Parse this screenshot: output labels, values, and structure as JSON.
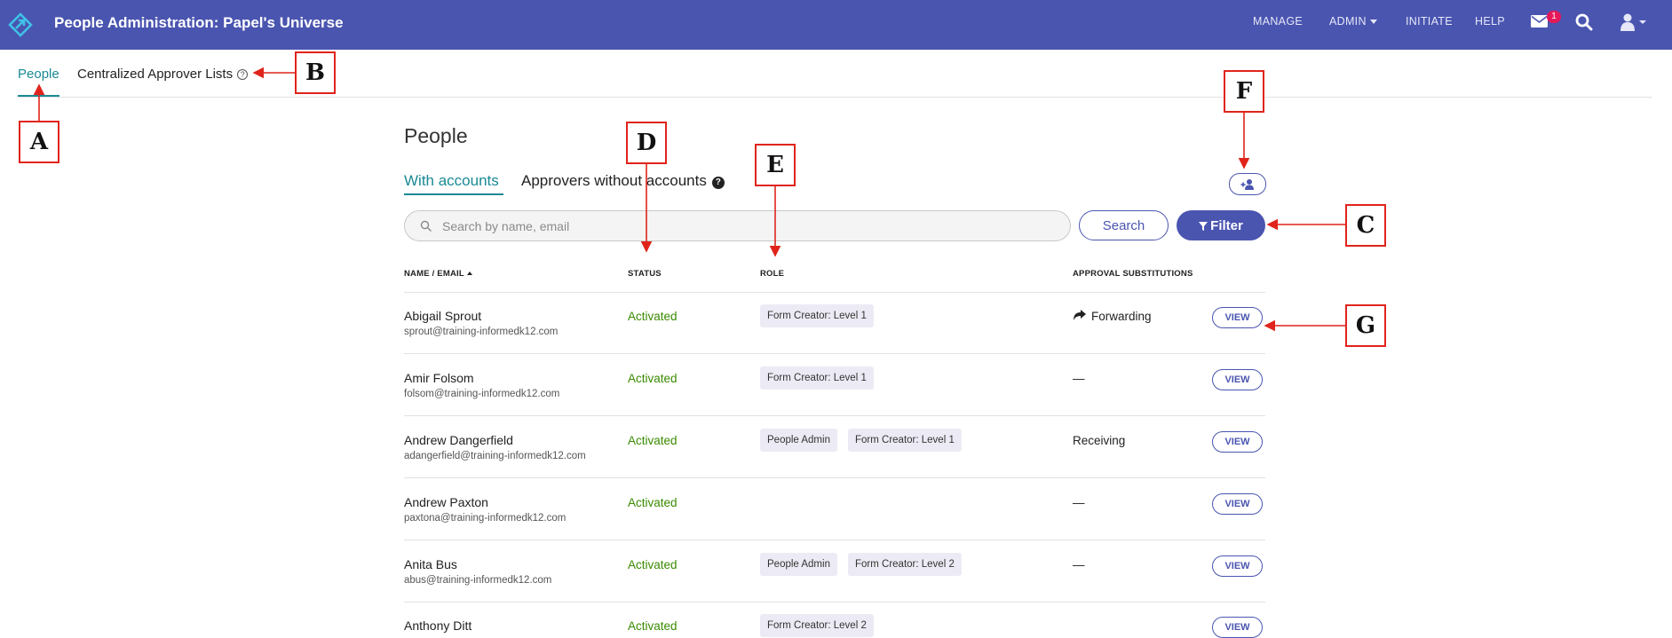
{
  "topbar": {
    "title": "People Administration: Papel's Universe",
    "nav": [
      "MANAGE",
      "ADMIN",
      "INITIATE",
      "HELP"
    ],
    "mail_badge": "1",
    "icons": [
      "app-logo-icon",
      "mail-icon",
      "search-icon",
      "user-icon"
    ]
  },
  "tabs": {
    "people": "People",
    "approver_lists": "Centralized Approver Lists",
    "help_glyph": "?"
  },
  "page": {
    "title": "People",
    "subtab_with": "With accounts",
    "subtab_without": "Approvers without accounts",
    "help_glyph": "?"
  },
  "search": {
    "placeholder": "Search by name, email",
    "value": "",
    "search_label": "Search",
    "filter_label": "Filter"
  },
  "table": {
    "headers": {
      "name": "NAME / EMAIL",
      "status": "STATUS",
      "role": "ROLE",
      "subs": "APPROVAL SUBSTITUTIONS"
    },
    "view_label": "VIEW",
    "rows": [
      {
        "name": "Abigail Sprout",
        "email": "sprout@training-informedk12.com",
        "status": "Activated",
        "roles": [
          "Form Creator: Level 1"
        ],
        "subs": "Forwarding"
      },
      {
        "name": "Amir Folsom",
        "email": "folsom@training-informedk12.com",
        "status": "Activated",
        "roles": [
          "Form Creator: Level 1"
        ],
        "subs": "—"
      },
      {
        "name": "Andrew Dangerfield",
        "email": "adangerfield@training-informedk12.com",
        "status": "Activated",
        "roles": [
          "People Admin",
          "Form Creator: Level 1"
        ],
        "subs": "Receiving"
      },
      {
        "name": "Andrew Paxton",
        "email": "paxtona@training-informedk12.com",
        "status": "Activated",
        "roles": [],
        "subs": "—"
      },
      {
        "name": "Anita Bus",
        "email": "abus@training-informedk12.com",
        "status": "Activated",
        "roles": [
          "People Admin",
          "Form Creator: Level 2"
        ],
        "subs": "—"
      },
      {
        "name": "Anthony Ditt",
        "email": "",
        "status": "Activated",
        "roles": [
          "Form Creator: Level 2"
        ],
        "subs": ""
      }
    ]
  },
  "annotations": [
    "A",
    "B",
    "C",
    "D",
    "E",
    "F",
    "G"
  ],
  "colors": {
    "topbar": "#4a55b0",
    "accent_teal": "#1a8a94",
    "status_green": "#3a8a00",
    "annotation_red": "#e0241b",
    "badge_red": "#e5195a"
  }
}
